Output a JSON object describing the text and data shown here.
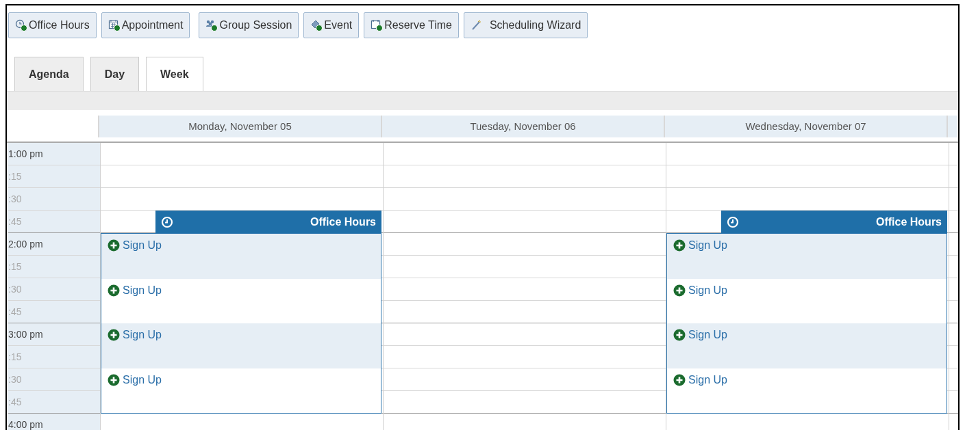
{
  "toolbar": [
    {
      "label": "Office Hours",
      "kind": "clock"
    },
    {
      "label": "Appointment",
      "kind": "calendar"
    },
    {
      "label": "Group Session",
      "kind": "group"
    },
    {
      "label": "Event",
      "kind": "ticket"
    },
    {
      "label": "Reserve Time",
      "kind": "reserve"
    },
    {
      "label": "Scheduling Wizard",
      "kind": "wand"
    }
  ],
  "tabs": [
    {
      "label": "Agenda",
      "selected": false
    },
    {
      "label": "Day",
      "selected": false
    },
    {
      "label": "Week",
      "selected": true
    }
  ],
  "times": [
    {
      "label": "1:00 pm",
      "kind": "hour"
    },
    {
      "label": ":15",
      "kind": "quarter"
    },
    {
      "label": ":30",
      "kind": "quarter"
    },
    {
      "label": ":45",
      "kind": "quarter"
    },
    {
      "label": "2:00 pm",
      "kind": "hour"
    },
    {
      "label": ":15",
      "kind": "quarter"
    },
    {
      "label": ":30",
      "kind": "quarter"
    },
    {
      "label": ":45",
      "kind": "quarter"
    },
    {
      "label": "3:00 pm",
      "kind": "hour"
    },
    {
      "label": ":15",
      "kind": "quarter"
    },
    {
      "label": ":30",
      "kind": "quarter"
    },
    {
      "label": ":45",
      "kind": "quarter"
    },
    {
      "label": "4:00 pm",
      "kind": "hour"
    }
  ],
  "days": [
    {
      "label": "Monday, November 05",
      "event": {
        "title": "Office Hours",
        "slots": [
          {
            "label": "Sign Up",
            "shaded": true
          },
          {
            "label": "Sign Up",
            "shaded": false
          },
          {
            "label": "Sign Up",
            "shaded": true
          },
          {
            "label": "Sign Up",
            "shaded": false
          }
        ]
      }
    },
    {
      "label": "Tuesday, November 06"
    },
    {
      "label": "Wednesday, November 07",
      "event": {
        "title": "Office Hours",
        "slots": [
          {
            "label": "Sign Up",
            "shaded": true
          },
          {
            "label": "Sign Up",
            "shaded": false
          },
          {
            "label": "Sign Up",
            "shaded": true
          },
          {
            "label": "Sign Up",
            "shaded": false
          }
        ]
      }
    }
  ]
}
